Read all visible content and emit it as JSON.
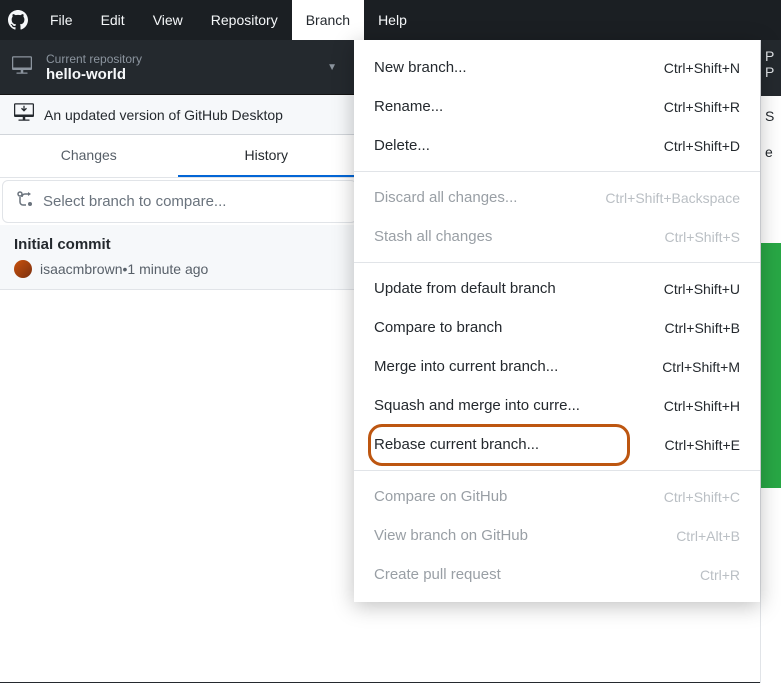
{
  "menubar": {
    "items": [
      "File",
      "Edit",
      "View",
      "Repository",
      "Branch",
      "Help"
    ],
    "active_index": 4
  },
  "repo_selector": {
    "label": "Current repository",
    "name": "hello-world"
  },
  "update_bar": {
    "text": "An updated version of GitHub Desktop"
  },
  "tabs": {
    "items": [
      "Changes",
      "History"
    ],
    "active_index": 1
  },
  "compare_bar": {
    "placeholder": "Select branch to compare..."
  },
  "commit": {
    "title": "Initial commit",
    "author": "isaacmbrown",
    "time_sep": " • ",
    "time": "1 minute ago"
  },
  "dropdown": {
    "groups": [
      [
        {
          "label": "New branch...",
          "shortcut": "Ctrl+Shift+N",
          "disabled": false
        },
        {
          "label": "Rename...",
          "shortcut": "Ctrl+Shift+R",
          "disabled": false
        },
        {
          "label": "Delete...",
          "shortcut": "Ctrl+Shift+D",
          "disabled": false
        }
      ],
      [
        {
          "label": "Discard all changes...",
          "shortcut": "Ctrl+Shift+Backspace",
          "disabled": true
        },
        {
          "label": "Stash all changes",
          "shortcut": "Ctrl+Shift+S",
          "disabled": true
        }
      ],
      [
        {
          "label": "Update from default branch",
          "shortcut": "Ctrl+Shift+U",
          "disabled": false
        },
        {
          "label": "Compare to branch",
          "shortcut": "Ctrl+Shift+B",
          "disabled": false
        },
        {
          "label": "Merge into current branch...",
          "shortcut": "Ctrl+Shift+M",
          "disabled": false
        },
        {
          "label": "Squash and merge into curre...",
          "shortcut": "Ctrl+Shift+H",
          "disabled": false,
          "highlighted": true
        },
        {
          "label": "Rebase current branch...",
          "shortcut": "Ctrl+Shift+E",
          "disabled": false
        }
      ],
      [
        {
          "label": "Compare on GitHub",
          "shortcut": "Ctrl+Shift+C",
          "disabled": true
        },
        {
          "label": "View branch on GitHub",
          "shortcut": "Ctrl+Alt+B",
          "disabled": true
        },
        {
          "label": "Create pull request",
          "shortcut": "Ctrl+R",
          "disabled": true
        }
      ]
    ]
  },
  "right_strip": {
    "p1": "P",
    "p2": "P",
    "s": "S",
    "e": "e"
  }
}
